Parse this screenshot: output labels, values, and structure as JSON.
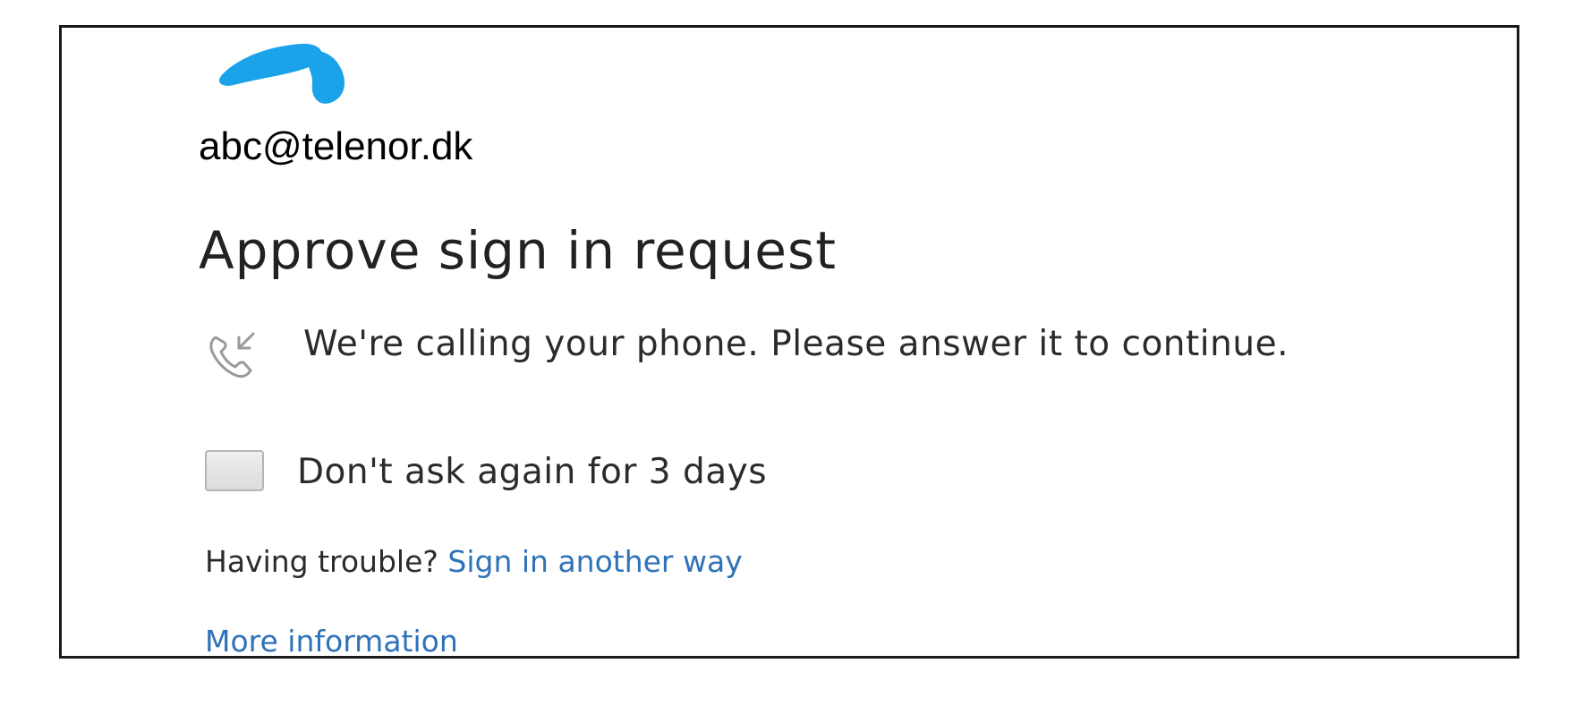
{
  "brand": {
    "logo_icon": "telenor-logo-icon",
    "logo_color": "#1aa3e8"
  },
  "account": {
    "email": "abc@telenor.dk"
  },
  "main": {
    "title": "Approve sign in request",
    "phone_icon": "incoming-call-icon",
    "message": "We're calling your phone. Please answer it to continue.",
    "remember": {
      "label": "Don't ask again for 3 days",
      "checked": false
    },
    "trouble_prefix": "Having trouble?",
    "trouble_link": "Sign in another way",
    "more_info_link": "More information",
    "link_color": "#2e72b8"
  }
}
